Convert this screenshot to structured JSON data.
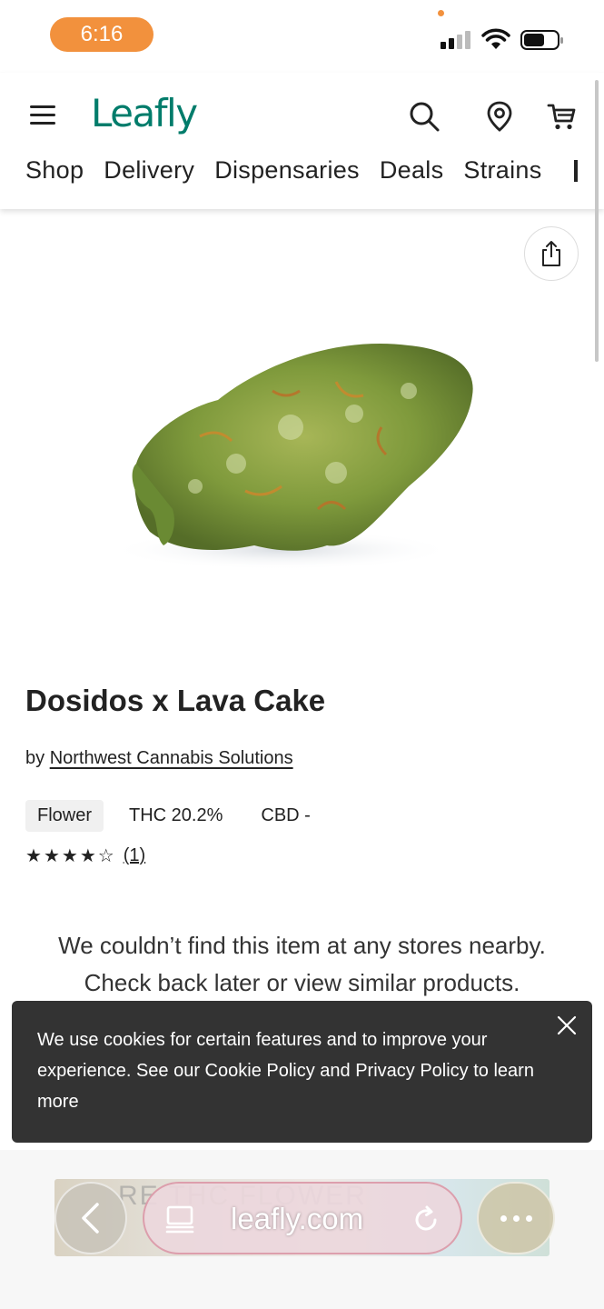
{
  "status_bar": {
    "time": "6:16",
    "accent": "#f2913d"
  },
  "header": {
    "logo": "Leafly",
    "brand_color": "#017c6b",
    "icons": [
      "menu-icon",
      "search-icon",
      "location-pin-icon",
      "cart-icon"
    ],
    "nav": [
      "Shop",
      "Delivery",
      "Dispensaries",
      "Deals",
      "Strains"
    ]
  },
  "product": {
    "name": "Dosidos x Lava Cake",
    "by_prefix": "by",
    "brand": "Northwest Cannabis Solutions",
    "category": "Flower",
    "thc": "THC 20.2%",
    "cbd": "CBD -",
    "rating_stars": 4,
    "rating_max": 5,
    "rating_count": "(1)"
  },
  "availability": {
    "message_line1": "We couldn’t find this item at any stores nearby.",
    "message_line2": "Check back later or view similar products."
  },
  "cookie_banner": {
    "text": "We use cookies for certain features and to improve your experience. See our Cookie Policy and Privacy Policy to learn more"
  },
  "browser": {
    "url": "leafly.com",
    "ad_text": "RE THC FLOWER"
  }
}
